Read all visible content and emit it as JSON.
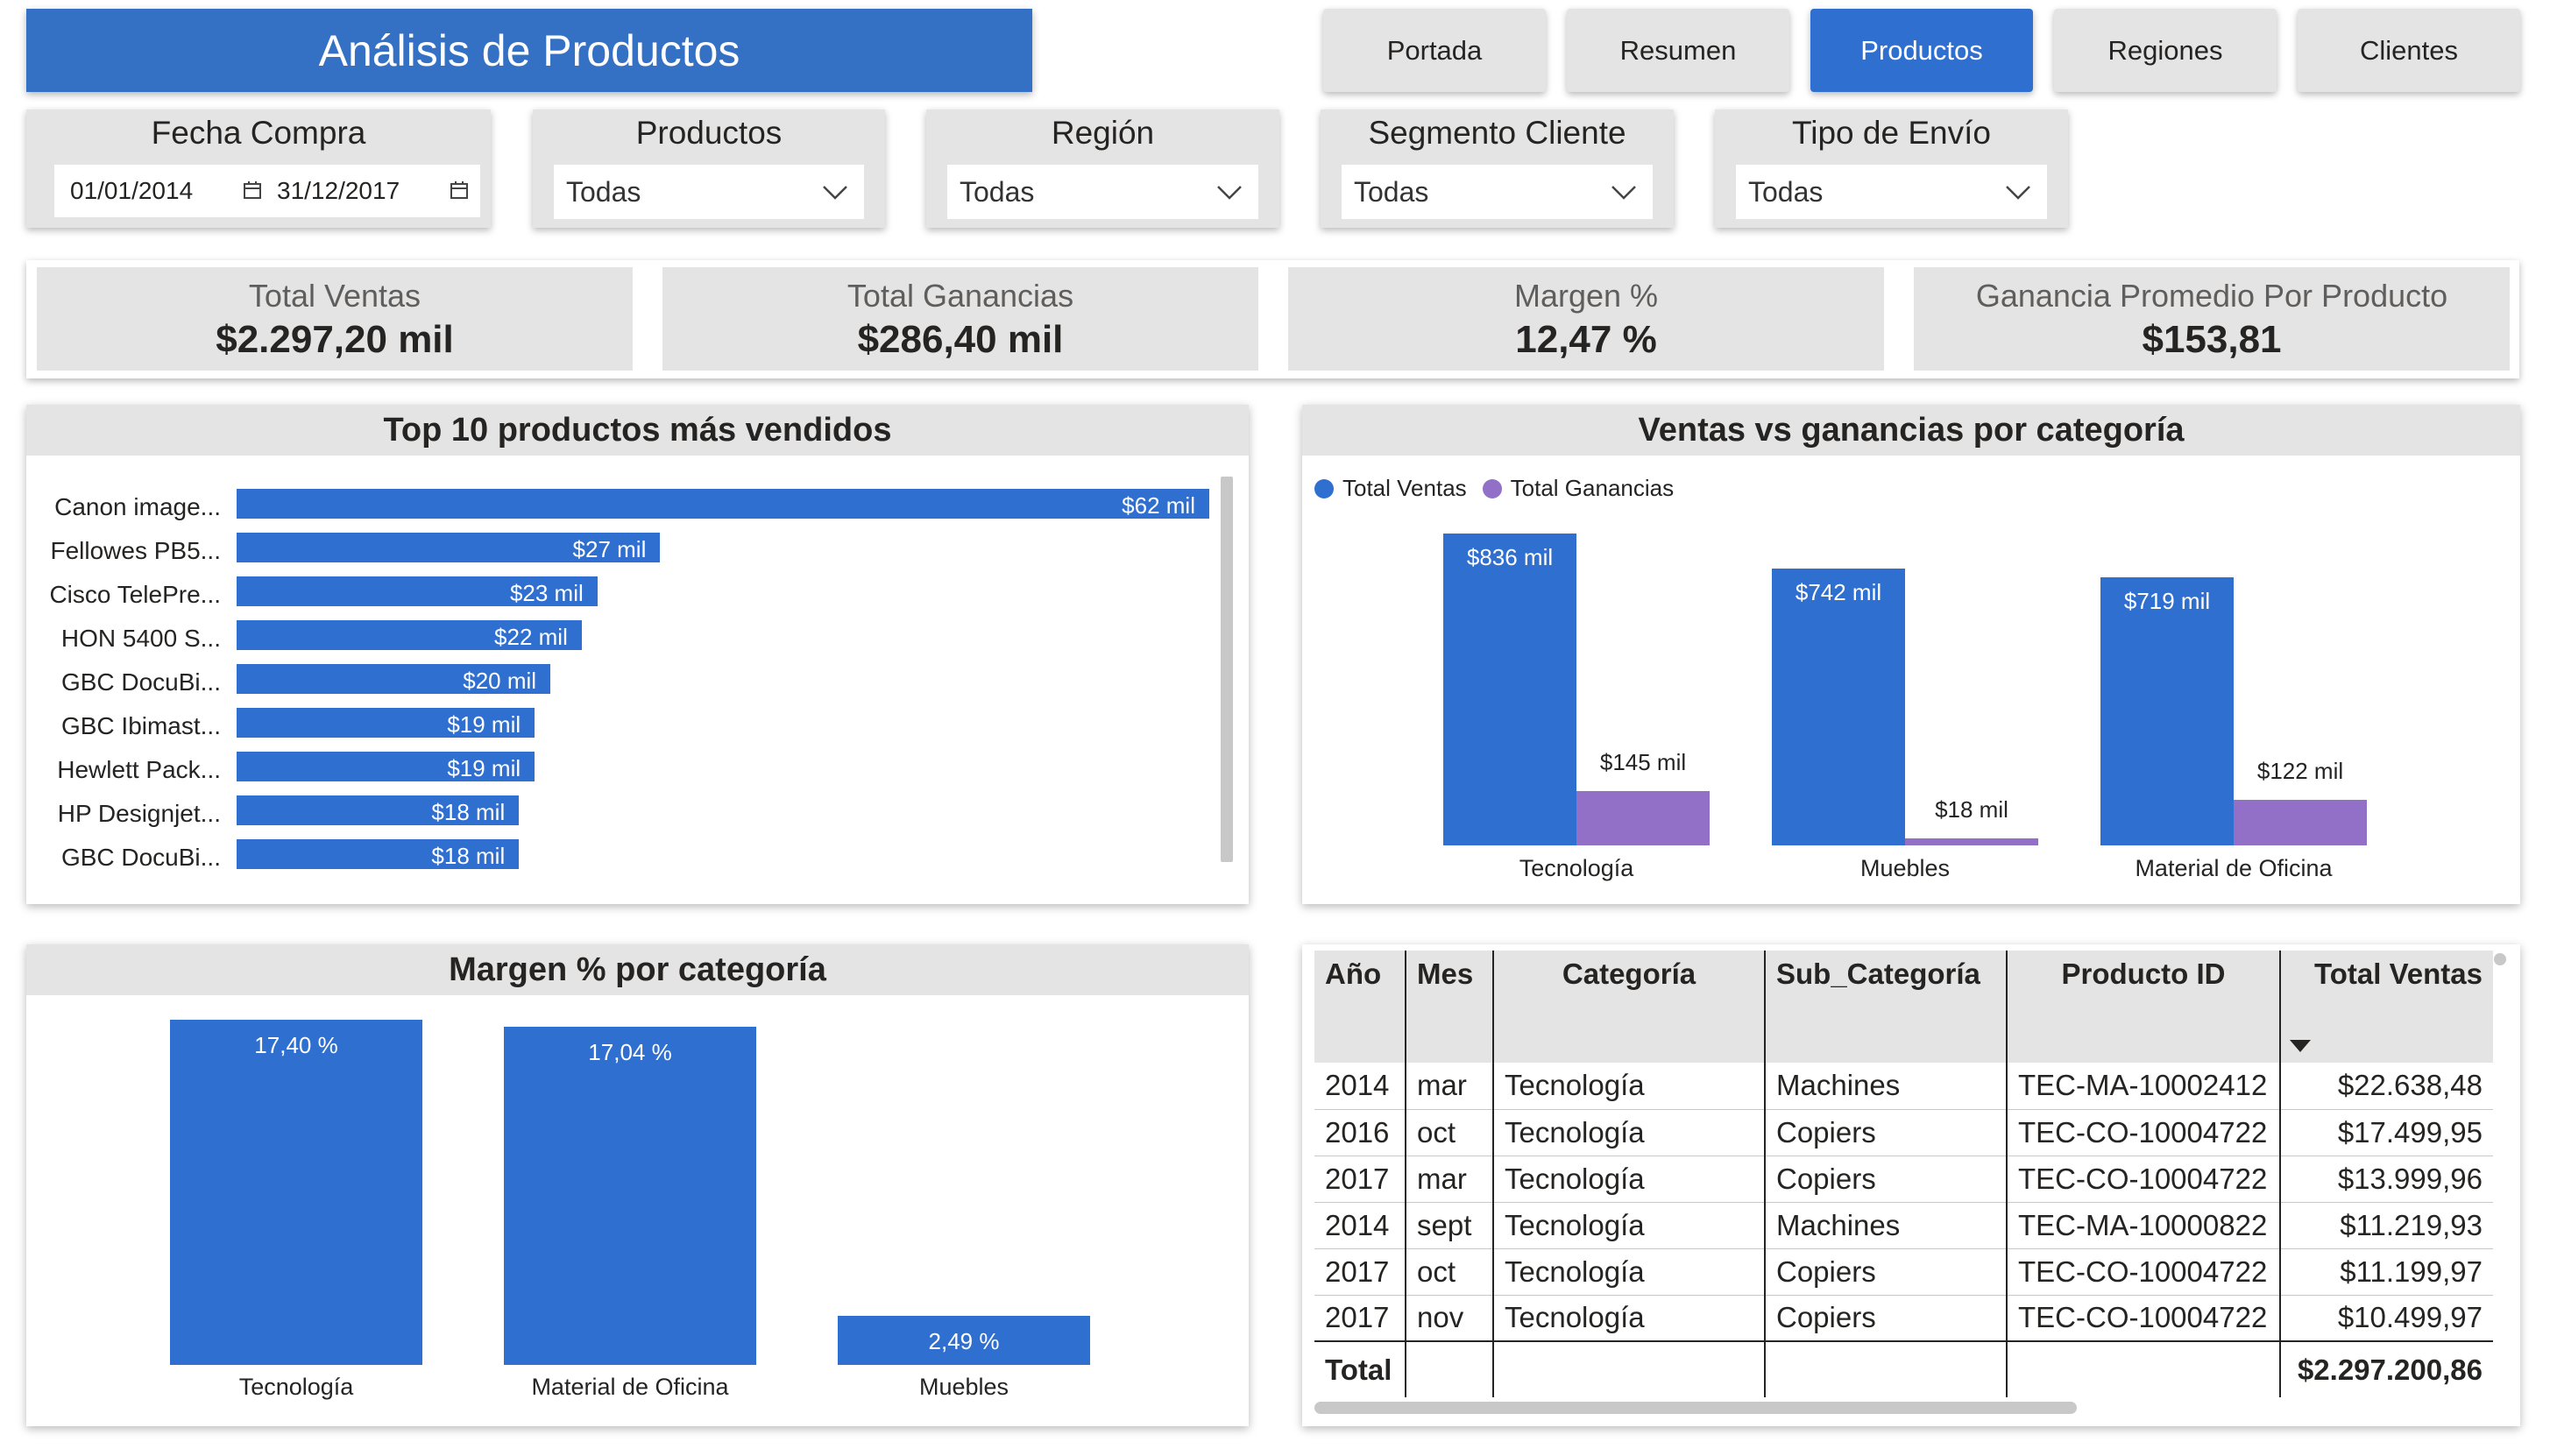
{
  "title": "Análisis de Productos",
  "nav": [
    {
      "label": "Portada",
      "active": false
    },
    {
      "label": "Resumen",
      "active": false
    },
    {
      "label": "Productos",
      "active": true
    },
    {
      "label": "Regiones",
      "active": false
    },
    {
      "label": "Clientes",
      "active": false
    }
  ],
  "slicers": {
    "fecha": {
      "title": "Fecha Compra",
      "start": "01/01/2014",
      "end": "31/12/2017"
    },
    "productos": {
      "title": "Productos",
      "value": "Todas"
    },
    "region": {
      "title": "Región",
      "value": "Todas"
    },
    "segmento": {
      "title": "Segmento Cliente",
      "value": "Todas"
    },
    "envio": {
      "title": "Tipo de Envío",
      "value": "Todas"
    }
  },
  "kpis": [
    {
      "label": "Total Ventas",
      "value": "$2.297,20 mil"
    },
    {
      "label": "Total Ganancias",
      "value": "$286,40 mil"
    },
    {
      "label": "Margen %",
      "value": "12,47 %"
    },
    {
      "label": "Ganancia Promedio Por Producto",
      "value": "$153,81"
    }
  ],
  "colors": {
    "blue": "#2f6fd0",
    "purple": "#9370c8",
    "header_gray": "#e4e4e4",
    "title_blue": "#3470c3"
  },
  "chart_data": [
    {
      "type": "bar",
      "orientation": "horizontal",
      "title": "Top 10 productos más vendidos",
      "categories": [
        "Canon image...",
        "Fellowes PB5...",
        "Cisco TelePre...",
        "HON 5400 S...",
        "GBC DocuBi...",
        "GBC Ibimast...",
        "Hewlett Pack...",
        "HP Designjet...",
        "GBC DocuBi..."
      ],
      "values": [
        62,
        27,
        23,
        22,
        20,
        19,
        19,
        18,
        18
      ],
      "value_labels": [
        "$62 mil",
        "$27 mil",
        "$23 mil",
        "$22 mil",
        "$20 mil",
        "$19 mil",
        "$19 mil",
        "$18 mil",
        "$18 mil"
      ],
      "xlim": [
        0,
        62
      ]
    },
    {
      "type": "bar",
      "title": "Ventas vs ganancias por categoría",
      "categories": [
        "Tecnología",
        "Muebles",
        "Material de Oficina"
      ],
      "series": [
        {
          "name": "Total Ventas",
          "values": [
            836,
            742,
            719
          ],
          "labels": [
            "$836 mil",
            "$742 mil",
            "$719 mil"
          ],
          "color": "#2f6fd0"
        },
        {
          "name": "Total Ganancias",
          "values": [
            145,
            18,
            122
          ],
          "labels": [
            "$145 mil",
            "$18 mil",
            "$122 mil"
          ],
          "color": "#9370c8"
        }
      ],
      "legend": "top-left",
      "ylim": [
        0,
        836
      ]
    },
    {
      "type": "bar",
      "title": "Margen % por categoría",
      "categories": [
        "Tecnología",
        "Material de Oficina",
        "Muebles"
      ],
      "values": [
        17.4,
        17.04,
        2.49
      ],
      "value_labels": [
        "17,40 %",
        "17,04 %",
        "2,49 %"
      ],
      "ylim": [
        0,
        17.4
      ]
    },
    {
      "type": "table",
      "columns": [
        "Año",
        "Mes",
        "Categoría",
        "Sub_Categoría",
        "Producto ID",
        "Total Ventas"
      ],
      "sort": {
        "column": "Total Ventas",
        "direction": "descending"
      },
      "rows": [
        [
          "2014",
          "mar",
          "Tecnología",
          "Machines",
          "TEC-MA-10002412",
          "$22.638,48"
        ],
        [
          "2016",
          "oct",
          "Tecnología",
          "Copiers",
          "TEC-CO-10004722",
          "$17.499,95"
        ],
        [
          "2017",
          "mar",
          "Tecnología",
          "Copiers",
          "TEC-CO-10004722",
          "$13.999,96"
        ],
        [
          "2014",
          "sept",
          "Tecnología",
          "Machines",
          "TEC-MA-10000822",
          "$11.219,93"
        ],
        [
          "2017",
          "oct",
          "Tecnología",
          "Copiers",
          "TEC-CO-10004722",
          "$11.199,97"
        ],
        [
          "2017",
          "nov",
          "Tecnología",
          "Copiers",
          "TEC-CO-10004722",
          "$10.499,97"
        ]
      ],
      "total": {
        "label": "Total",
        "value": "$2.297.200,86"
      }
    }
  ]
}
